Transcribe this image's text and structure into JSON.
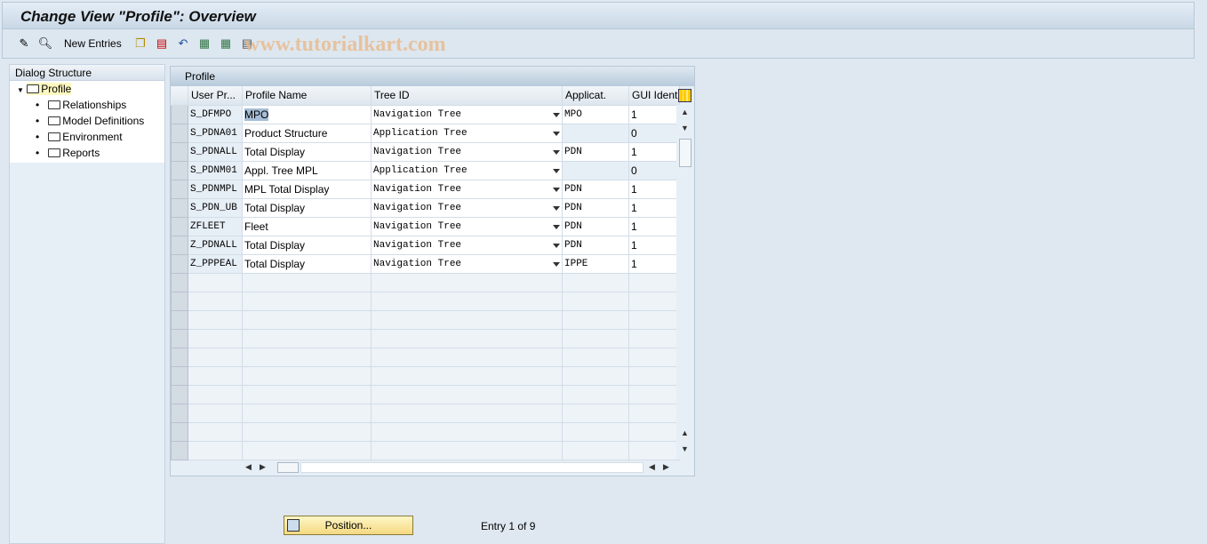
{
  "title": "Change View \"Profile\": Overview",
  "watermark": "www.tutorialkart.com",
  "toolbar": {
    "new_entries": "New Entries",
    "icons": [
      "change-display-icon",
      "find-icon",
      "copy-icon",
      "delete-icon",
      "undo-icon",
      "select-all-icon",
      "select-block-icon",
      "deselect-all-icon"
    ]
  },
  "dialog": {
    "header": "Dialog Structure",
    "items": [
      {
        "label": "Profile",
        "selected": true
      },
      {
        "label": "Relationships"
      },
      {
        "label": "Model Definitions"
      },
      {
        "label": "Environment"
      },
      {
        "label": "Reports"
      }
    ]
  },
  "table": {
    "title": "Profile",
    "columns": [
      "User Pr...",
      "Profile Name",
      "Tree ID",
      "Applicat.",
      "GUI Ident"
    ],
    "rows": [
      [
        "S_DFMPO",
        "MPO",
        "Navigation Tree",
        "MPO",
        "1"
      ],
      [
        "S_PDNA01",
        "Product Structure",
        "Application Tree",
        "",
        "0"
      ],
      [
        "S_PDNALL",
        "Total Display",
        "Navigation Tree",
        "PDN",
        "1"
      ],
      [
        "S_PDNM01",
        "Appl. Tree MPL",
        "Application Tree",
        "",
        "0"
      ],
      [
        "S_PDNMPL",
        "MPL Total Display",
        "Navigation Tree",
        "PDN",
        "1"
      ],
      [
        "S_PDN_UB",
        "Total Display",
        "Navigation Tree",
        "PDN",
        "1"
      ],
      [
        "ZFLEET",
        "Fleet",
        "Navigation Tree",
        "PDN",
        "1"
      ],
      [
        "Z_PDNALL",
        "Total Display",
        "Navigation Tree",
        "PDN",
        "1"
      ],
      [
        "Z_PPPEAL",
        "Total Display",
        "Navigation Tree",
        "IPPE",
        "1"
      ]
    ]
  },
  "footer": {
    "position": "Position...",
    "entry": "Entry 1 of 9"
  }
}
